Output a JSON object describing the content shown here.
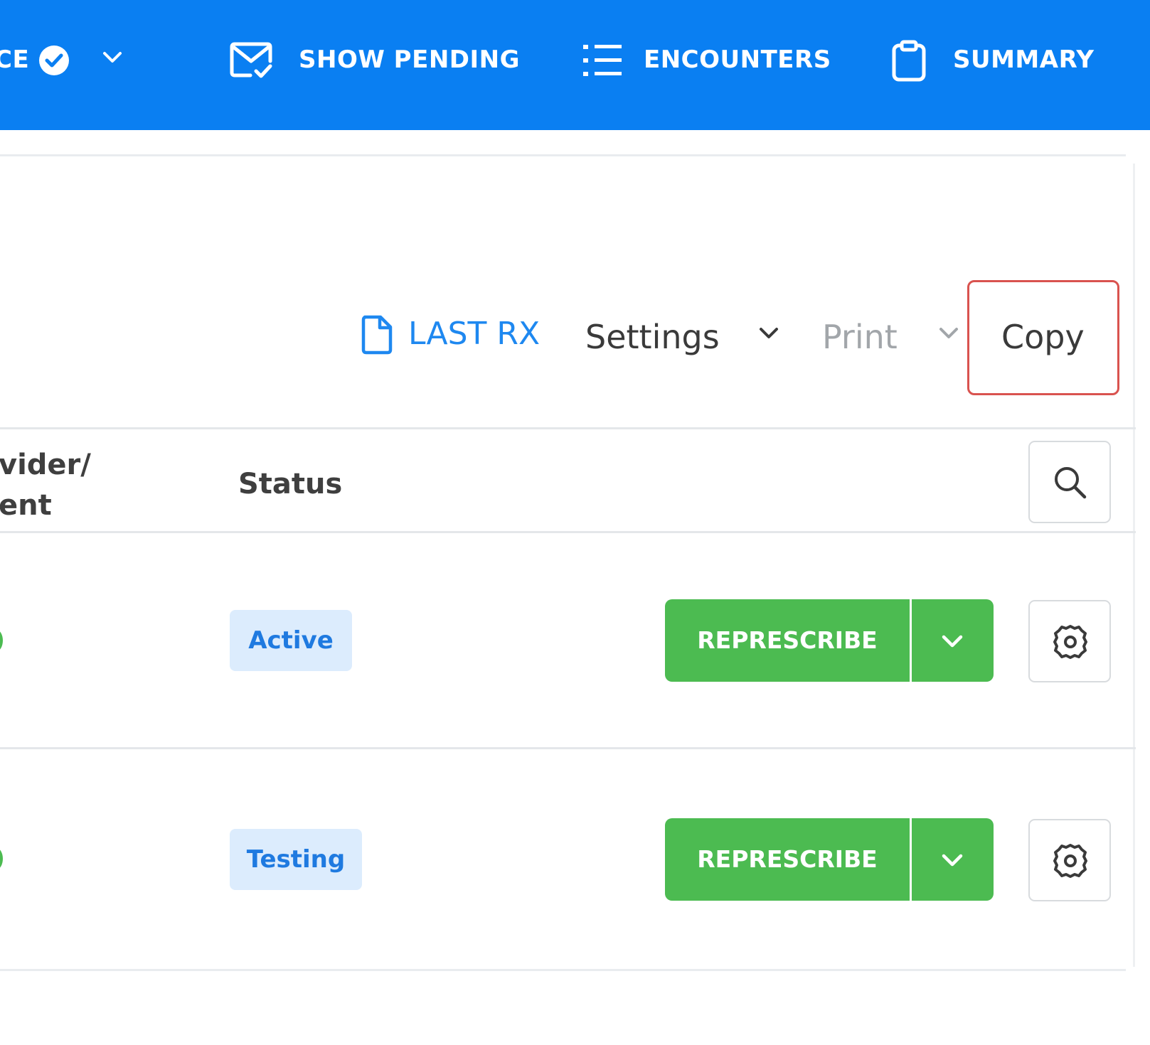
{
  "topbar": {
    "partial_label": "CE",
    "items": [
      {
        "label": "SHOW PENDING",
        "icon": "mail-check-icon"
      },
      {
        "label": "ENCOUNTERS",
        "icon": "list-icon"
      },
      {
        "label": "SUMMARY",
        "icon": "clipboard-icon"
      }
    ]
  },
  "toolbar": {
    "last_rx": "LAST RX",
    "settings": "Settings",
    "print": "Print",
    "copy": "Copy"
  },
  "table": {
    "headers": {
      "provider_line1": "vider/",
      "provider_line2": "ent",
      "status": "Status"
    },
    "rows": [
      {
        "status": "Active",
        "action": "REPRESCRIBE"
      },
      {
        "status": "Testing",
        "action": "REPRESCRIBE"
      }
    ]
  },
  "colors": {
    "nav_blue": "#0a7ff2",
    "green": "#4cbb51",
    "badge_bg": "#dcecfd",
    "badge_text": "#1f7ae0",
    "highlight": "#d9534f"
  }
}
